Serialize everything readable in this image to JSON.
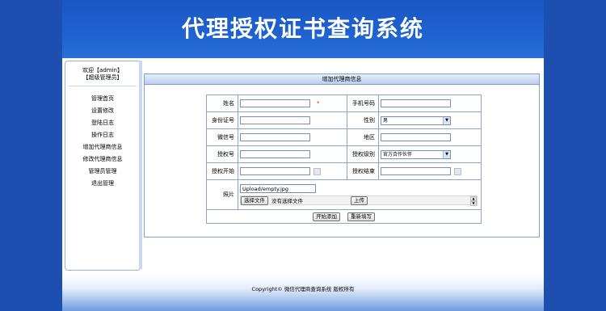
{
  "header": {
    "title": "代理授权证书查询系统"
  },
  "sidebar": {
    "welcome_line1": "欢迎【admin】",
    "welcome_line2": "【超级管理员】",
    "items": [
      {
        "label": "管理首页"
      },
      {
        "label": "设置修改"
      },
      {
        "label": "登陆日志"
      },
      {
        "label": "操作日志"
      },
      {
        "label": "增加代理商信息"
      },
      {
        "label": "修改代理商信息"
      },
      {
        "label": "管理员管理"
      },
      {
        "label": "退出管理"
      }
    ]
  },
  "panel": {
    "title": "增加代理商信息"
  },
  "form": {
    "name_label": "姓名",
    "required_mark": "*",
    "phone_label": "手机号码",
    "id_label": "身份证号",
    "gender_label": "性别",
    "gender_value": "男",
    "wechat_label": "微信号",
    "region_label": "地区",
    "auth_no_label": "授权号",
    "level_label": "授权级别",
    "level_value": "官方合作伙伴",
    "start_label": "授权开始",
    "end_label": "授权结束",
    "photo_label": "照片",
    "photo_value": "Upload/empty.jpg",
    "choose_file": "选择文件",
    "no_file": "没有选择文件",
    "upload": "上传",
    "submit": "开始添加",
    "reset": "重新填写"
  },
  "footer": {
    "copyright": "Copyright© 微信代理商查询系统 版权所有"
  }
}
